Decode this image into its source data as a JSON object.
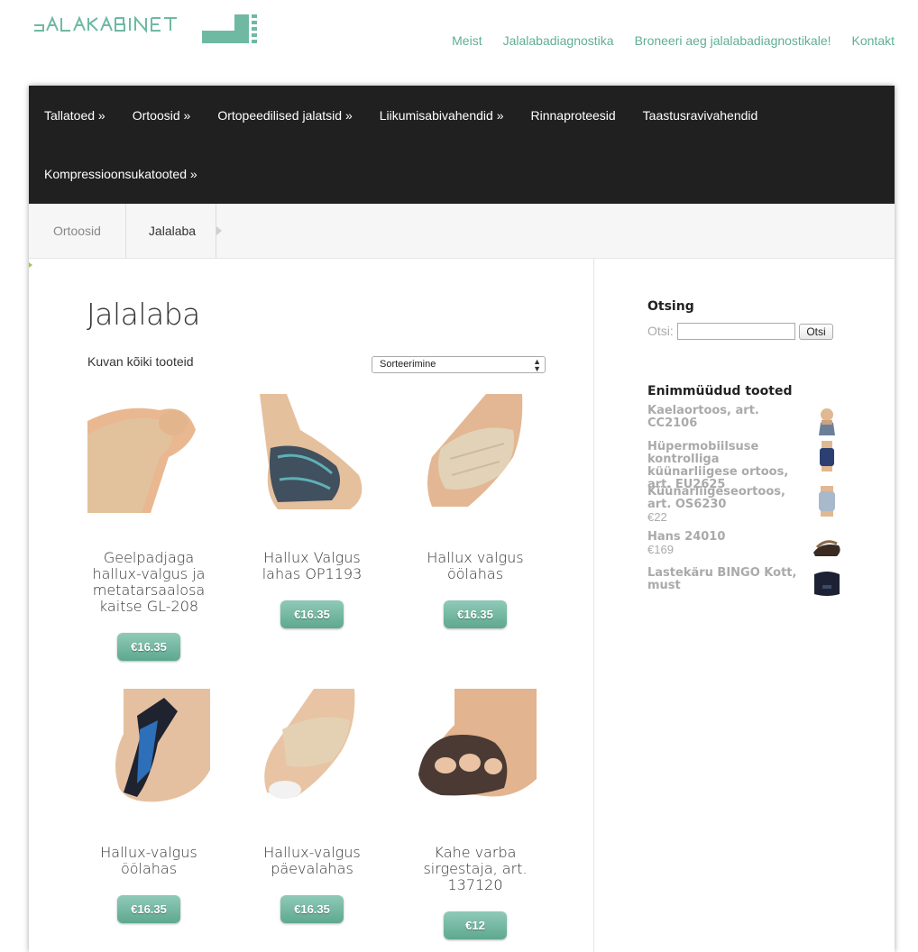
{
  "header": {
    "nav": [
      "Meist",
      "Jalalabadiagnostika",
      "Broneeri aeg jalalabadiagnostikale!",
      "Kontakt"
    ]
  },
  "category_nav": [
    "Tallatoed »",
    "Ortoosid »",
    "Ortopeedilised jalatsid »",
    "Liikumisabivahendid »",
    "Rinnaproteesid",
    "Taastusravivahendid",
    "Kompressioonsukatooted »"
  ],
  "breadcrumb": [
    "Ortoosid",
    "Jalalaba"
  ],
  "main": {
    "title": "Jalalaba",
    "result_count": "Kuvan kõiki tooteid",
    "sort_label": "Sorteerimine",
    "products": [
      {
        "name": "Geelpadjaga hallux-valgus ja metatarsaalosa kaitse GL-208",
        "price": "€16.35"
      },
      {
        "name": "Hallux Valgus lahas OP1193",
        "price": "€16.35"
      },
      {
        "name": "Hallux valgus öölahas",
        "price": "€16.35"
      },
      {
        "name": "Hallux-valgus öölahas",
        "price": "€16.35"
      },
      {
        "name": "Hallux-valgus päevalahas",
        "price": "€16.35"
      },
      {
        "name": "Kahe varba sirgestaja, art. 137120",
        "price": "€12"
      }
    ]
  },
  "sidebar": {
    "search_title": "Otsing",
    "search_label": "Otsi:",
    "search_button": "Otsi",
    "bestsellers_title": "Enimmüüdud tooted",
    "bestsellers": [
      {
        "name": "Kaelaortoos, art. CC2106",
        "price": ""
      },
      {
        "name": "Hüpermobiilsuse kontrolliga küünarliigese ortoos, art. EU2625",
        "price": ""
      },
      {
        "name": "Küünarliigeseortoos, art. OS6230",
        "price": "€22"
      },
      {
        "name": "Hans 24010",
        "price": "€169"
      },
      {
        "name": "Lastekäru BINGO Kott, must",
        "price": ""
      }
    ]
  },
  "colors": {
    "accent": "#5fae96",
    "nav_bg": "#1f201f"
  }
}
